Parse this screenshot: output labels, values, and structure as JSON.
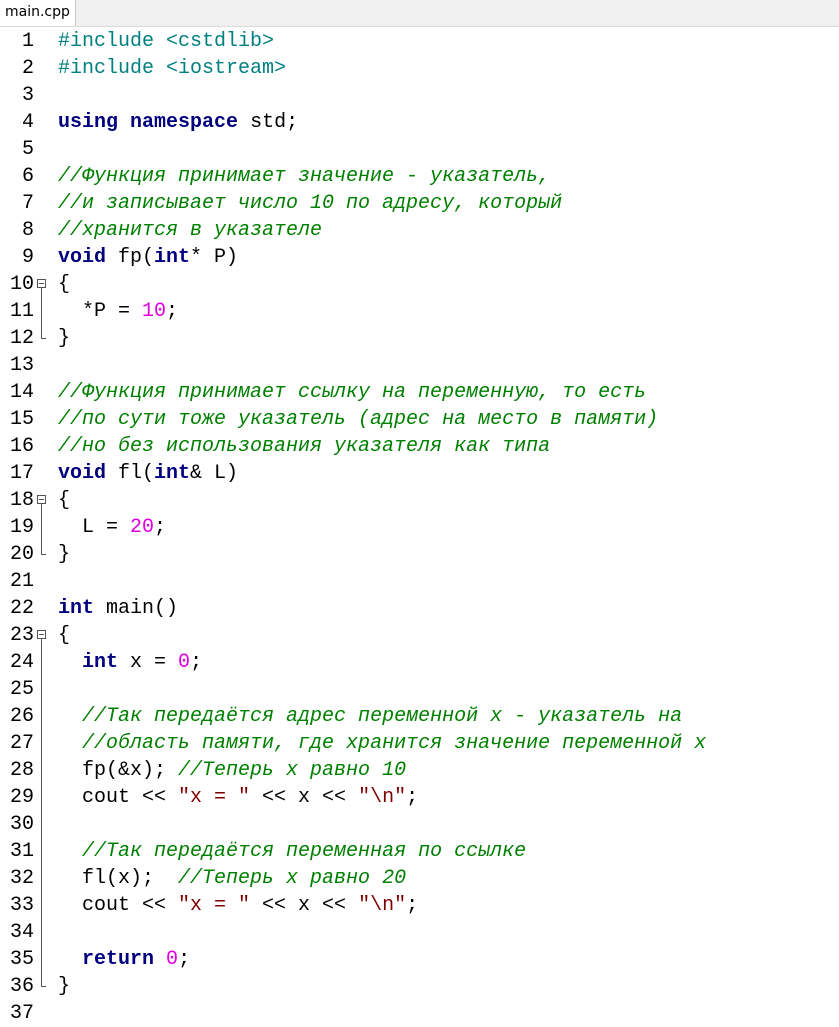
{
  "tab": {
    "label": "main.cpp"
  },
  "lines": [
    {
      "n": "1",
      "tokens": [
        {
          "t": "pp",
          "v": "#include <cstdlib>"
        }
      ]
    },
    {
      "n": "2",
      "tokens": [
        {
          "t": "pp",
          "v": "#include <iostream>"
        }
      ]
    },
    {
      "n": "3",
      "tokens": []
    },
    {
      "n": "4",
      "tokens": [
        {
          "t": "kw",
          "v": "using"
        },
        {
          "t": "p",
          "v": " "
        },
        {
          "t": "kw",
          "v": "namespace"
        },
        {
          "t": "p",
          "v": " std;"
        }
      ]
    },
    {
      "n": "5",
      "tokens": []
    },
    {
      "n": "6",
      "tokens": [
        {
          "t": "cm",
          "v": "//Функция принимает значение - указатель,"
        }
      ]
    },
    {
      "n": "7",
      "tokens": [
        {
          "t": "cm",
          "v": "//и записывает число 10 по адресу, который"
        }
      ]
    },
    {
      "n": "8",
      "tokens": [
        {
          "t": "cm",
          "v": "//хранится в указателе"
        }
      ]
    },
    {
      "n": "9",
      "tokens": [
        {
          "t": "kw",
          "v": "void"
        },
        {
          "t": "p",
          "v": " fp("
        },
        {
          "t": "kw",
          "v": "int"
        },
        {
          "t": "p",
          "v": "* P)"
        }
      ]
    },
    {
      "n": "10",
      "fold": "start",
      "tokens": [
        {
          "t": "p",
          "v": "{"
        }
      ]
    },
    {
      "n": "11",
      "fold": "mid",
      "tokens": [
        {
          "t": "p",
          "v": "  *P = "
        },
        {
          "t": "num",
          "v": "10"
        },
        {
          "t": "p",
          "v": ";"
        }
      ]
    },
    {
      "n": "12",
      "fold": "end",
      "tokens": [
        {
          "t": "p",
          "v": "}"
        }
      ]
    },
    {
      "n": "13",
      "tokens": []
    },
    {
      "n": "14",
      "tokens": [
        {
          "t": "cm",
          "v": "//Функция принимает ссылку на переменную, то есть"
        }
      ]
    },
    {
      "n": "15",
      "tokens": [
        {
          "t": "cm",
          "v": "//по сути тоже указатель (адрес на место в памяти)"
        }
      ]
    },
    {
      "n": "16",
      "tokens": [
        {
          "t": "cm",
          "v": "//но без использования указателя как типа"
        }
      ]
    },
    {
      "n": "17",
      "tokens": [
        {
          "t": "kw",
          "v": "void"
        },
        {
          "t": "p",
          "v": " fl("
        },
        {
          "t": "kw",
          "v": "int"
        },
        {
          "t": "p",
          "v": "& L)"
        }
      ]
    },
    {
      "n": "18",
      "fold": "start",
      "tokens": [
        {
          "t": "p",
          "v": "{"
        }
      ]
    },
    {
      "n": "19",
      "fold": "mid",
      "tokens": [
        {
          "t": "p",
          "v": "  L = "
        },
        {
          "t": "num",
          "v": "20"
        },
        {
          "t": "p",
          "v": ";"
        }
      ]
    },
    {
      "n": "20",
      "fold": "end",
      "tokens": [
        {
          "t": "p",
          "v": "}"
        }
      ]
    },
    {
      "n": "21",
      "tokens": []
    },
    {
      "n": "22",
      "tokens": [
        {
          "t": "kw",
          "v": "int"
        },
        {
          "t": "p",
          "v": " main()"
        }
      ]
    },
    {
      "n": "23",
      "fold": "start",
      "tokens": [
        {
          "t": "p",
          "v": "{"
        }
      ]
    },
    {
      "n": "24",
      "fold": "mid",
      "tokens": [
        {
          "t": "p",
          "v": "  "
        },
        {
          "t": "kw",
          "v": "int"
        },
        {
          "t": "p",
          "v": " x = "
        },
        {
          "t": "num",
          "v": "0"
        },
        {
          "t": "p",
          "v": ";"
        }
      ]
    },
    {
      "n": "25",
      "fold": "mid",
      "tokens": []
    },
    {
      "n": "26",
      "fold": "mid",
      "tokens": [
        {
          "t": "p",
          "v": "  "
        },
        {
          "t": "cm",
          "v": "//Так передаётся адрес переменной x - указатель на"
        }
      ]
    },
    {
      "n": "27",
      "fold": "mid",
      "tokens": [
        {
          "t": "p",
          "v": "  "
        },
        {
          "t": "cm",
          "v": "//область памяти, где хранится значение переменной x"
        }
      ]
    },
    {
      "n": "28",
      "fold": "mid",
      "tokens": [
        {
          "t": "p",
          "v": "  fp(&x); "
        },
        {
          "t": "cm",
          "v": "//Теперь x равно 10"
        }
      ]
    },
    {
      "n": "29",
      "fold": "mid",
      "tokens": [
        {
          "t": "p",
          "v": "  cout << "
        },
        {
          "t": "str",
          "v": "\"x = \""
        },
        {
          "t": "p",
          "v": " << x << "
        },
        {
          "t": "str",
          "v": "\"\\n\""
        },
        {
          "t": "p",
          "v": ";"
        }
      ]
    },
    {
      "n": "30",
      "fold": "mid",
      "tokens": []
    },
    {
      "n": "31",
      "fold": "mid",
      "tokens": [
        {
          "t": "p",
          "v": "  "
        },
        {
          "t": "cm",
          "v": "//Так передаётся переменная по ссылке"
        }
      ]
    },
    {
      "n": "32",
      "fold": "mid",
      "tokens": [
        {
          "t": "p",
          "v": "  fl(x);  "
        },
        {
          "t": "cm",
          "v": "//Теперь x равно 20"
        }
      ]
    },
    {
      "n": "33",
      "fold": "mid",
      "tokens": [
        {
          "t": "p",
          "v": "  cout << "
        },
        {
          "t": "str",
          "v": "\"x = \""
        },
        {
          "t": "p",
          "v": " << x << "
        },
        {
          "t": "str",
          "v": "\"\\n\""
        },
        {
          "t": "p",
          "v": ";"
        }
      ]
    },
    {
      "n": "34",
      "fold": "mid",
      "tokens": []
    },
    {
      "n": "35",
      "fold": "mid",
      "tokens": [
        {
          "t": "p",
          "v": "  "
        },
        {
          "t": "kw",
          "v": "return"
        },
        {
          "t": "p",
          "v": " "
        },
        {
          "t": "num",
          "v": "0"
        },
        {
          "t": "p",
          "v": ";"
        }
      ]
    },
    {
      "n": "36",
      "fold": "end",
      "tokens": [
        {
          "t": "p",
          "v": "}"
        }
      ]
    },
    {
      "n": "37",
      "tokens": []
    }
  ]
}
